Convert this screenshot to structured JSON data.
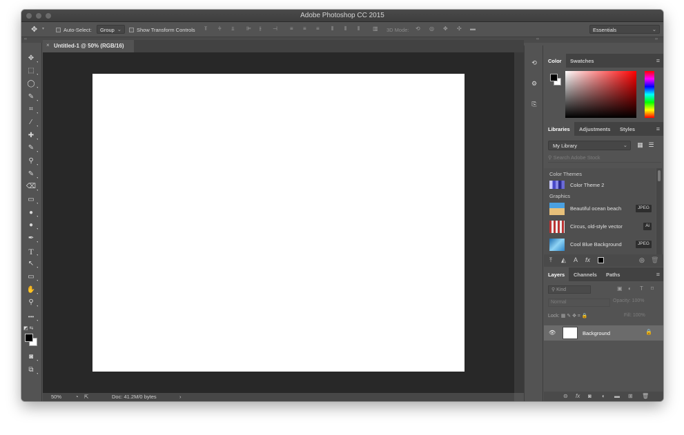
{
  "window": {
    "title": "Adobe Photoshop CC 2015"
  },
  "options_bar": {
    "auto_select_label": "Auto-Select:",
    "auto_select_value": "Group",
    "show_transform_label": "Show Transform Controls",
    "mode_3d_label": "3D Mode:",
    "workspace": "Essentials"
  },
  "document": {
    "tab_title": "Untitled-1 @ 50% (RGB/16)",
    "tab_close": "×"
  },
  "statusbar": {
    "zoom": "50%",
    "doc_info": "Doc: 41.2M/0 bytes",
    "arrow": "›"
  },
  "color_panel": {
    "tabs": [
      "Color",
      "Swatches"
    ],
    "foreground": "#000000",
    "background": "#ffffff"
  },
  "libraries_panel": {
    "tabs": [
      "Libraries",
      "Adjustments",
      "Styles"
    ],
    "library_name": "My Library",
    "search_placeholder": "Search Adobe Stock",
    "section_color_themes": "Color Themes",
    "color_theme_item": "Color Theme 2",
    "section_graphics": "Graphics",
    "graphics": [
      {
        "name": "Beautiful ocean beach",
        "badge": "JPEG"
      },
      {
        "name": "Circus, old-style vector",
        "badge": "Ai"
      },
      {
        "name": "Cool Blue Background",
        "badge": "JPEG"
      }
    ]
  },
  "layers_panel": {
    "tabs": [
      "Layers",
      "Channels",
      "Paths"
    ],
    "filter_placeholder": "Kind",
    "blend_mode": "Normal",
    "opacity_label": "Opacity: 100%",
    "lock_label": "Lock:",
    "fill_label": "Fill: 100%",
    "layers": [
      {
        "name": "Background",
        "locked": true,
        "visible": true
      }
    ]
  },
  "icons": {
    "move": "✥",
    "marquee": "⬚",
    "lasso": "◯",
    "quick_select": "✎",
    "crop": "⌗",
    "eyedropper": "⁄",
    "healing": "✚",
    "brush": "✎",
    "stamp": "⚲",
    "history_brush": "✎",
    "eraser": "⌫",
    "gradient": "▭",
    "blur": "●",
    "dodge": "●",
    "pen": "✒",
    "type": "T",
    "path_select": "↖",
    "rectangle": "▭",
    "hand": "✋",
    "zoom": "⚲",
    "more": "•••"
  }
}
